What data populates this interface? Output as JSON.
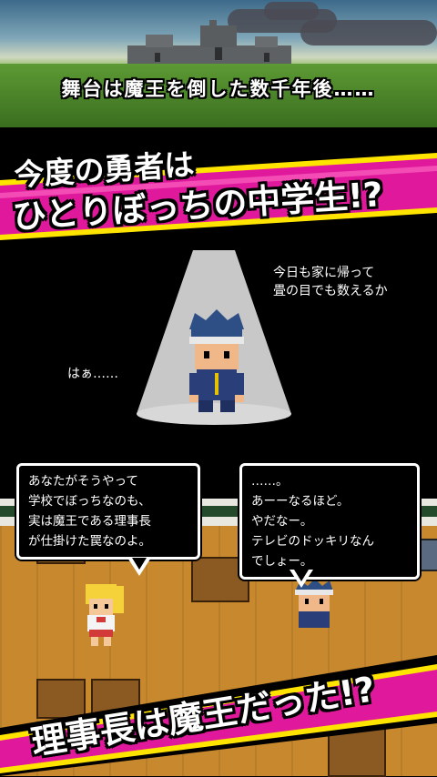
{
  "top": {
    "caption": "舞台は魔王を倒した数千年後……"
  },
  "banner1": {
    "line1": "今度の勇者は",
    "line2": "ひとりぼっちの中学生!?"
  },
  "spotlight": {
    "thought": "今日も家に帰って\n畳の目でも数えるか",
    "sigh": "はぁ……"
  },
  "dialogs": {
    "left": "あなたがそうやって\n学校でぼっちなのも、\n実は魔王である理事長\nが仕掛けた罠なのよ。",
    "right": "……。\nあーーなるほど。\nやだなー。\nテレビのドッキリなん\nでしょー。"
  },
  "banner2": {
    "text": "理事長は魔王だった!?"
  },
  "colors": {
    "magenta": "#e0199c",
    "yellow": "#ffe400",
    "floor": "#c8882e"
  }
}
